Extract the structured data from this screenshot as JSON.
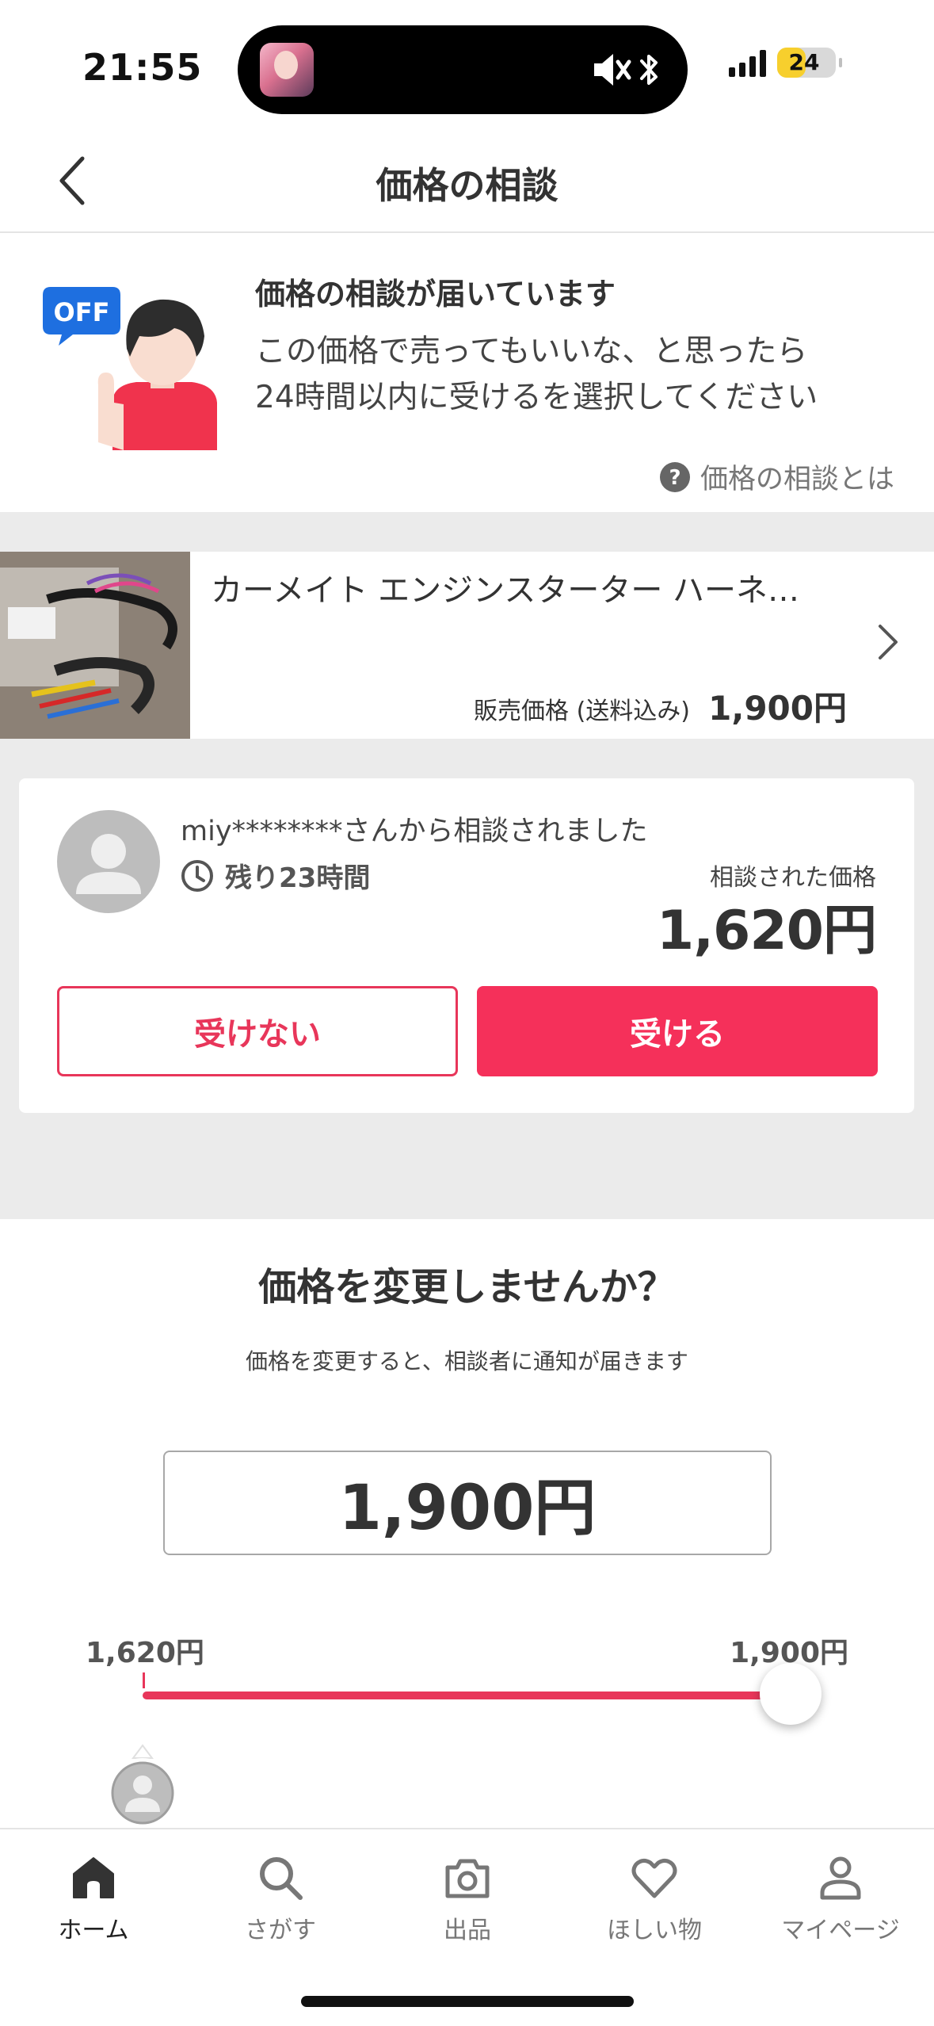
{
  "status_bar": {
    "time": "21:55",
    "battery_level": "24",
    "battery_fraction": 0.24,
    "icons": [
      "signal-icon",
      "mute-icon",
      "bluetooth-icon",
      "battery-icon"
    ]
  },
  "nav": {
    "title": "価格の相談",
    "back_icon": "chevron-left-icon"
  },
  "notice": {
    "badge": "OFF",
    "title": "価格の相談が届いています",
    "line1": "この価格で売ってもいいな、と思ったら",
    "line2": "24時間以内に受けるを選択してください",
    "help_link": "価格の相談とは"
  },
  "product": {
    "name": "カーメイト エンジンスターター ハーネ…",
    "price_label": "販売価格 (送料込み)",
    "price": "1,900円"
  },
  "offer": {
    "from": "miy********さんから相談されました",
    "remaining": "残り23時間",
    "price_label": "相談された価格",
    "price": "1,620円",
    "decline_label": "受けない",
    "accept_label": "受ける"
  },
  "change": {
    "title": "価格を変更しませんか？",
    "subtitle": "価格を変更すると、相談者に通知が届きます",
    "input_value": "1,900円",
    "slider": {
      "min_label": "1,620円",
      "max_label": "1,900円",
      "min": 1620,
      "max": 1900,
      "value": 1900
    }
  },
  "tabs": [
    {
      "label": "ホーム",
      "icon": "home-icon",
      "active": true
    },
    {
      "label": "さがす",
      "icon": "search-icon",
      "active": false
    },
    {
      "label": "出品",
      "icon": "camera-icon",
      "active": false
    },
    {
      "label": "ほしい物",
      "icon": "heart-icon",
      "active": false
    },
    {
      "label": "マイページ",
      "icon": "person-icon",
      "active": false
    }
  ],
  "colors": {
    "accent": "#f5305a",
    "accent_border": "#e8365a",
    "background_gray": "#ebebeb",
    "badge_blue": "#1a73e8"
  }
}
